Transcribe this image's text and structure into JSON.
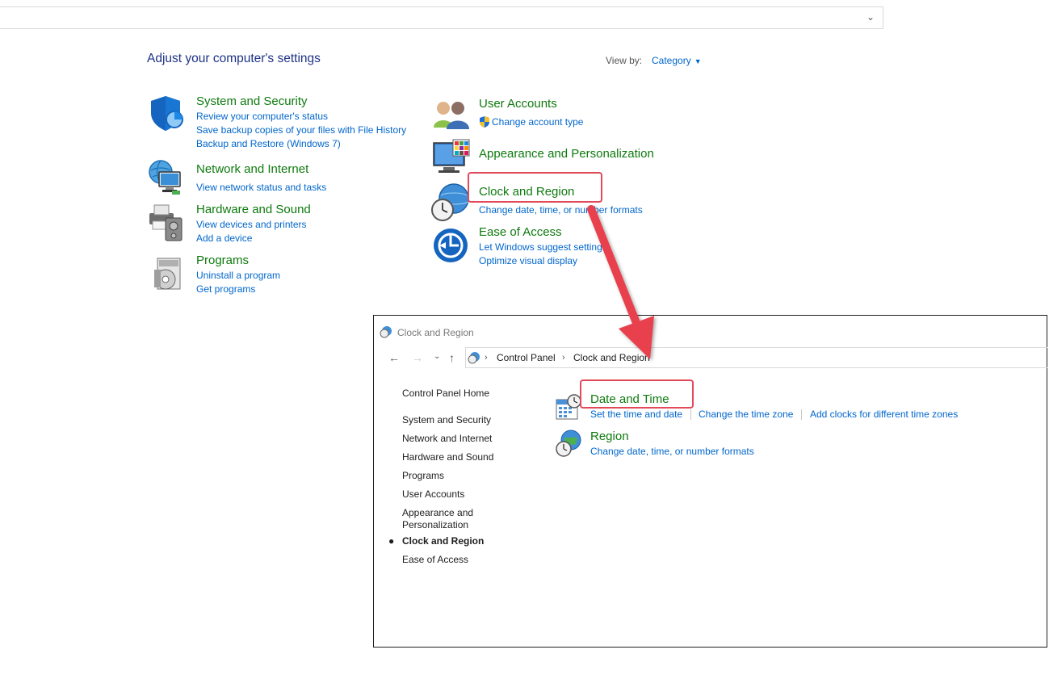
{
  "page": {
    "title": "Adjust your computer's settings",
    "view_by_label": "View by:",
    "view_by_value": "Category"
  },
  "categories_left": [
    {
      "title": "System and Security",
      "links": [
        "Review your computer's status",
        "Save backup copies of your files with File History",
        "Backup and Restore (Windows 7)"
      ]
    },
    {
      "title": "Network and Internet",
      "links": [
        "View network status and tasks"
      ]
    },
    {
      "title": "Hardware and Sound",
      "links": [
        "View devices and printers",
        "Add a device"
      ]
    },
    {
      "title": "Programs",
      "links": [
        "Uninstall a program",
        "Get programs"
      ]
    }
  ],
  "categories_right": [
    {
      "title": "User Accounts",
      "links": [
        "Change account type"
      ]
    },
    {
      "title": "Appearance and Personalization",
      "links": []
    },
    {
      "title": "Clock and Region",
      "links": [
        "Change date, time, or number formats"
      ]
    },
    {
      "title": "Ease of Access",
      "links": [
        "Let Windows suggest settings",
        "Optimize visual display"
      ]
    }
  ],
  "window": {
    "title": "Clock and Region",
    "breadcrumb": [
      "Control Panel",
      "Clock and Region"
    ],
    "sidebar_home": "Control Panel Home",
    "sidebar_items": [
      "System and Security",
      "Network and Internet",
      "Hardware and Sound",
      "Programs",
      "User Accounts",
      "Appearance and",
      "Personalization",
      "Clock and Region",
      "Ease of Access"
    ],
    "sections": [
      {
        "title": "Date and Time",
        "links": [
          "Set the time and date",
          "Change the time zone",
          "Add clocks for different time zones"
        ]
      },
      {
        "title": "Region",
        "links": [
          "Change date, time, or number formats"
        ]
      }
    ]
  },
  "colors": {
    "category_title": "#0e7a0e",
    "link": "#0066cc",
    "highlight": "#e24a5a",
    "arrow": "#e8404e"
  }
}
